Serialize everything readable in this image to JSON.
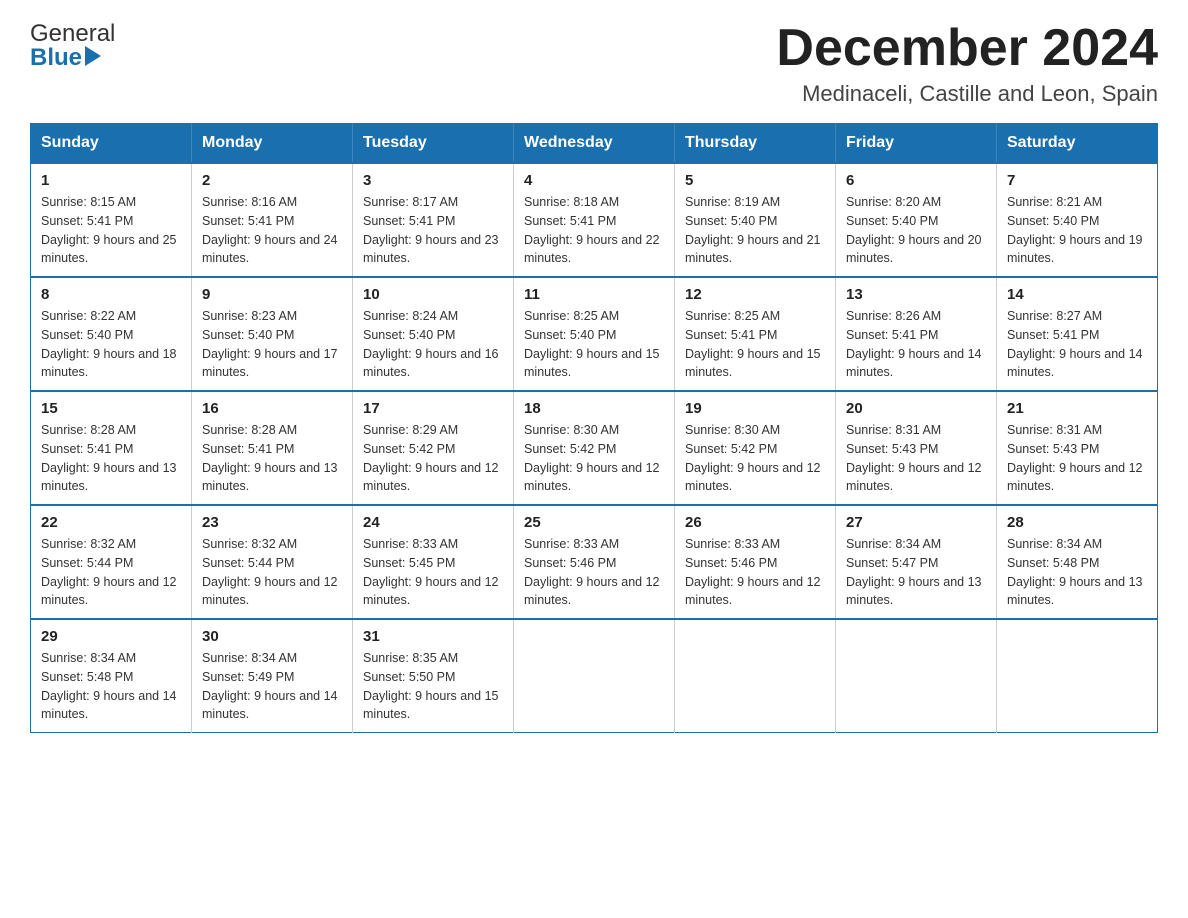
{
  "header": {
    "logo_general": "General",
    "logo_blue": "Blue",
    "title": "December 2024",
    "subtitle": "Medinaceli, Castille and Leon, Spain"
  },
  "weekdays": [
    "Sunday",
    "Monday",
    "Tuesday",
    "Wednesday",
    "Thursday",
    "Friday",
    "Saturday"
  ],
  "weeks": [
    [
      {
        "day": "1",
        "sunrise": "8:15 AM",
        "sunset": "5:41 PM",
        "daylight": "9 hours and 25 minutes."
      },
      {
        "day": "2",
        "sunrise": "8:16 AM",
        "sunset": "5:41 PM",
        "daylight": "9 hours and 24 minutes."
      },
      {
        "day": "3",
        "sunrise": "8:17 AM",
        "sunset": "5:41 PM",
        "daylight": "9 hours and 23 minutes."
      },
      {
        "day": "4",
        "sunrise": "8:18 AM",
        "sunset": "5:41 PM",
        "daylight": "9 hours and 22 minutes."
      },
      {
        "day": "5",
        "sunrise": "8:19 AM",
        "sunset": "5:40 PM",
        "daylight": "9 hours and 21 minutes."
      },
      {
        "day": "6",
        "sunrise": "8:20 AM",
        "sunset": "5:40 PM",
        "daylight": "9 hours and 20 minutes."
      },
      {
        "day": "7",
        "sunrise": "8:21 AM",
        "sunset": "5:40 PM",
        "daylight": "9 hours and 19 minutes."
      }
    ],
    [
      {
        "day": "8",
        "sunrise": "8:22 AM",
        "sunset": "5:40 PM",
        "daylight": "9 hours and 18 minutes."
      },
      {
        "day": "9",
        "sunrise": "8:23 AM",
        "sunset": "5:40 PM",
        "daylight": "9 hours and 17 minutes."
      },
      {
        "day": "10",
        "sunrise": "8:24 AM",
        "sunset": "5:40 PM",
        "daylight": "9 hours and 16 minutes."
      },
      {
        "day": "11",
        "sunrise": "8:25 AM",
        "sunset": "5:40 PM",
        "daylight": "9 hours and 15 minutes."
      },
      {
        "day": "12",
        "sunrise": "8:25 AM",
        "sunset": "5:41 PM",
        "daylight": "9 hours and 15 minutes."
      },
      {
        "day": "13",
        "sunrise": "8:26 AM",
        "sunset": "5:41 PM",
        "daylight": "9 hours and 14 minutes."
      },
      {
        "day": "14",
        "sunrise": "8:27 AM",
        "sunset": "5:41 PM",
        "daylight": "9 hours and 14 minutes."
      }
    ],
    [
      {
        "day": "15",
        "sunrise": "8:28 AM",
        "sunset": "5:41 PM",
        "daylight": "9 hours and 13 minutes."
      },
      {
        "day": "16",
        "sunrise": "8:28 AM",
        "sunset": "5:41 PM",
        "daylight": "9 hours and 13 minutes."
      },
      {
        "day": "17",
        "sunrise": "8:29 AM",
        "sunset": "5:42 PM",
        "daylight": "9 hours and 12 minutes."
      },
      {
        "day": "18",
        "sunrise": "8:30 AM",
        "sunset": "5:42 PM",
        "daylight": "9 hours and 12 minutes."
      },
      {
        "day": "19",
        "sunrise": "8:30 AM",
        "sunset": "5:42 PM",
        "daylight": "9 hours and 12 minutes."
      },
      {
        "day": "20",
        "sunrise": "8:31 AM",
        "sunset": "5:43 PM",
        "daylight": "9 hours and 12 minutes."
      },
      {
        "day": "21",
        "sunrise": "8:31 AM",
        "sunset": "5:43 PM",
        "daylight": "9 hours and 12 minutes."
      }
    ],
    [
      {
        "day": "22",
        "sunrise": "8:32 AM",
        "sunset": "5:44 PM",
        "daylight": "9 hours and 12 minutes."
      },
      {
        "day": "23",
        "sunrise": "8:32 AM",
        "sunset": "5:44 PM",
        "daylight": "9 hours and 12 minutes."
      },
      {
        "day": "24",
        "sunrise": "8:33 AM",
        "sunset": "5:45 PM",
        "daylight": "9 hours and 12 minutes."
      },
      {
        "day": "25",
        "sunrise": "8:33 AM",
        "sunset": "5:46 PM",
        "daylight": "9 hours and 12 minutes."
      },
      {
        "day": "26",
        "sunrise": "8:33 AM",
        "sunset": "5:46 PM",
        "daylight": "9 hours and 12 minutes."
      },
      {
        "day": "27",
        "sunrise": "8:34 AM",
        "sunset": "5:47 PM",
        "daylight": "9 hours and 13 minutes."
      },
      {
        "day": "28",
        "sunrise": "8:34 AM",
        "sunset": "5:48 PM",
        "daylight": "9 hours and 13 minutes."
      }
    ],
    [
      {
        "day": "29",
        "sunrise": "8:34 AM",
        "sunset": "5:48 PM",
        "daylight": "9 hours and 14 minutes."
      },
      {
        "day": "30",
        "sunrise": "8:34 AM",
        "sunset": "5:49 PM",
        "daylight": "9 hours and 14 minutes."
      },
      {
        "day": "31",
        "sunrise": "8:35 AM",
        "sunset": "5:50 PM",
        "daylight": "9 hours and 15 minutes."
      },
      null,
      null,
      null,
      null
    ]
  ]
}
